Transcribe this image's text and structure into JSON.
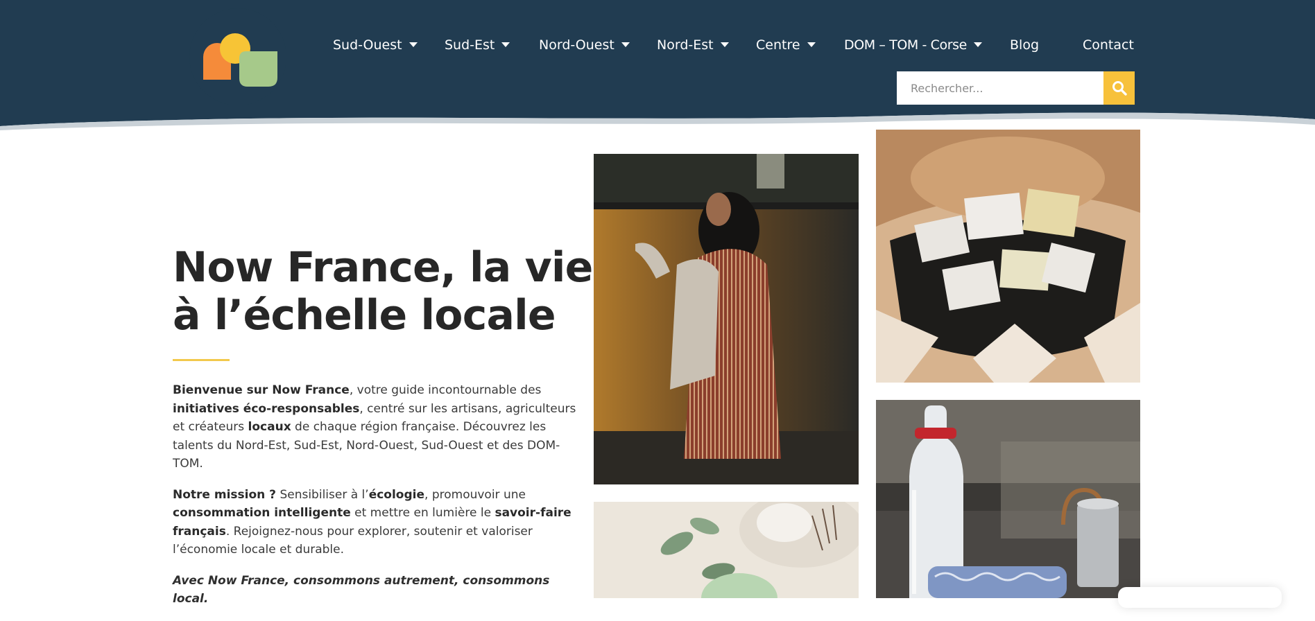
{
  "brand": {
    "logo_icon": "now-france-logo",
    "colors": {
      "header_bg": "#213c51",
      "accent_yellow": "#f7c13b",
      "logo_orange": "#f58b3a",
      "logo_yellow": "#f7c436",
      "logo_green": "#a6c98a"
    }
  },
  "nav": {
    "items": [
      {
        "label": "Sud-Ouest",
        "has_dropdown": true
      },
      {
        "label": "Sud-Est",
        "has_dropdown": true
      },
      {
        "label": "Nord-Ouest",
        "has_dropdown": true
      },
      {
        "label": "Nord-Est",
        "has_dropdown": true
      },
      {
        "label": "Centre",
        "has_dropdown": true
      },
      {
        "label": "DOM – TOM - Corse",
        "has_dropdown": true
      },
      {
        "label": "Blog",
        "has_dropdown": false
      },
      {
        "label": "Contact",
        "has_dropdown": false
      }
    ]
  },
  "search": {
    "placeholder": "Rechercher...",
    "value": "",
    "button_icon": "search-icon"
  },
  "hero": {
    "title_line1": "Now France, la vie",
    "title_line2": "à l’échelle locale",
    "p1": {
      "b1": "Bienvenue sur Now France",
      "t1": ", votre guide incontournable des ",
      "b2": "initiatives éco-responsables",
      "t2": ", centré sur les artisans, agriculteurs et créateurs ",
      "b3": "locaux",
      "t3": " de chaque région française. Découvrez les talents du Nord-Est, Sud-Est, Nord-Ouest, Sud-Ouest et des DOM-TOM."
    },
    "p2": {
      "b1": "Notre mission ?",
      "t1": " Sensibiliser à l’",
      "b2": "écologie",
      "t2": ", promouvoir une ",
      "b3": "consommation intelligente",
      "t3": " et mettre en lumière le ",
      "b4": "savoir-faire français",
      "t4": ". Rejoignez-nous pour explorer, soutenir et valoriser l’économie locale et durable."
    },
    "tagline": "Avec Now France, consommons autrement, consommons local."
  },
  "gallery": {
    "photos": [
      {
        "subject": "woman-striped-shawl-photo"
      },
      {
        "subject": "soap-bars-paper-photo"
      },
      {
        "subject": "soap-eucalyptus-photo"
      },
      {
        "subject": "glass-bottle-kettle-photo"
      }
    ]
  }
}
